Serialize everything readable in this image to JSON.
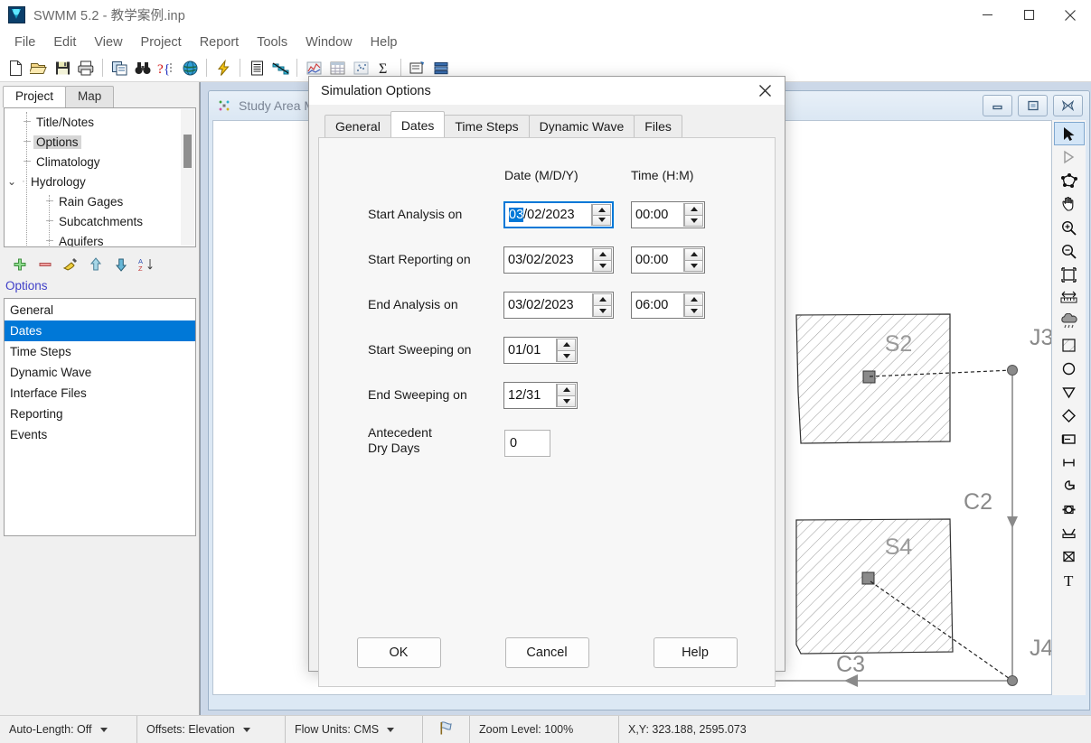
{
  "window": {
    "title": "SWMM 5.2 - 教学案例.inp",
    "icon": "swmm-app-icon",
    "minimize": "minimize-icon",
    "maximize": "maximize-icon",
    "close": "close-icon"
  },
  "menubar": {
    "items": [
      "File",
      "Edit",
      "View",
      "Project",
      "Report",
      "Tools",
      "Window",
      "Help"
    ]
  },
  "toolbar": {
    "groups": [
      [
        "new-file-icon",
        "open-folder-icon",
        "save-disk-icon",
        "print-icon"
      ],
      [
        "copy-icon",
        "find-binoculars-icon",
        "query-icon",
        "globe-icon"
      ],
      [
        "run-lightning-icon"
      ],
      [
        "report-document-icon",
        "profile-plot-icon"
      ],
      [
        "time-series-chart-icon",
        "table-icon",
        "scatter-plot-icon",
        "statistics-sigma-icon"
      ],
      [
        "map-overview-icon",
        "layers-icon"
      ]
    ]
  },
  "sidebar": {
    "tabs": [
      {
        "label": "Project",
        "active": true
      },
      {
        "label": "Map",
        "active": false
      }
    ],
    "tree": [
      {
        "label": "Title/Notes",
        "depth": 1,
        "selected": false,
        "expandable": false
      },
      {
        "label": "Options",
        "depth": 1,
        "selected": true,
        "expandable": false
      },
      {
        "label": "Climatology",
        "depth": 1,
        "selected": false,
        "expandable": false
      },
      {
        "label": "Hydrology",
        "depth": 0,
        "selected": false,
        "expandable": true,
        "expanded": true
      },
      {
        "label": "Rain Gages",
        "depth": 2,
        "selected": false,
        "expandable": false
      },
      {
        "label": "Subcatchments",
        "depth": 2,
        "selected": false,
        "expandable": false
      },
      {
        "label": "Aquifers",
        "depth": 2,
        "selected": false,
        "expandable": false
      }
    ],
    "mini_toolbar": [
      "add-plus-icon",
      "delete-minus-icon",
      "edit-pencil-icon",
      "move-up-icon",
      "move-down-icon",
      "sort-az-icon"
    ],
    "caption": "Options",
    "options_list": [
      {
        "label": "General",
        "selected": false
      },
      {
        "label": "Dates",
        "selected": true
      },
      {
        "label": "Time Steps",
        "selected": false
      },
      {
        "label": "Dynamic Wave",
        "selected": false
      },
      {
        "label": "Interface Files",
        "selected": false
      },
      {
        "label": "Reporting",
        "selected": false
      },
      {
        "label": "Events",
        "selected": false
      }
    ]
  },
  "map_window": {
    "title": "Study Area Map",
    "icon": "study-area-map-icon",
    "minimize": "restore-down-icon",
    "maximize": "maximize-window-icon",
    "close": "close-window-icon",
    "labels": {
      "s2": "S2",
      "s4": "S4",
      "j3": "J3",
      "j4": "J4",
      "c2": "C2",
      "c3": "C3"
    },
    "tools": [
      {
        "name": "select-object-arrow-icon",
        "active": true
      },
      {
        "name": "select-vertex-arrow-icon",
        "active": false
      },
      {
        "name": "select-region-polygon-icon",
        "active": false
      },
      {
        "name": "pan-hand-icon",
        "active": false
      },
      {
        "name": "zoom-in-icon",
        "active": false
      },
      {
        "name": "zoom-out-icon",
        "active": false
      },
      {
        "name": "full-extent-icon",
        "active": false
      },
      {
        "name": "measure-distance-icon",
        "active": false
      },
      {
        "name": "add-rain-gage-icon",
        "active": false
      },
      {
        "name": "add-subcatchment-icon",
        "active": false
      },
      {
        "name": "add-junction-node-icon",
        "active": false
      },
      {
        "name": "add-outfall-node-icon",
        "active": false
      },
      {
        "name": "add-divider-node-icon",
        "active": false
      },
      {
        "name": "add-storage-unit-icon",
        "active": false
      },
      {
        "name": "add-conduit-link-icon",
        "active": false
      },
      {
        "name": "add-pump-link-icon",
        "active": false
      },
      {
        "name": "add-orifice-link-icon",
        "active": false
      },
      {
        "name": "add-weir-link-icon",
        "active": false
      },
      {
        "name": "add-outlet-link-icon",
        "active": false
      },
      {
        "name": "add-label-text-icon",
        "active": false
      }
    ]
  },
  "dialog": {
    "title": "Simulation Options",
    "close": "close-icon",
    "tabs": [
      {
        "label": "General",
        "active": false
      },
      {
        "label": "Dates",
        "active": true
      },
      {
        "label": "Time Steps",
        "active": false
      },
      {
        "label": "Dynamic Wave",
        "active": false
      },
      {
        "label": "Files",
        "active": false
      }
    ],
    "column_headers": {
      "date": "Date (M/D/Y)",
      "time": "Time (H:M)"
    },
    "fields": [
      {
        "label": "Start Analysis on",
        "date_value": "03/02/2023",
        "date_selected_part": "03",
        "date_focused": true,
        "time_value": "00:00"
      },
      {
        "label": "Start Reporting on",
        "date_value": "03/02/2023",
        "date_focused": false,
        "time_value": "00:00"
      },
      {
        "label": "End Analysis on",
        "date_value": "03/02/2023",
        "date_focused": false,
        "time_value": "06:00"
      }
    ],
    "sweeping": [
      {
        "label": "Start Sweeping on",
        "value": "01/01"
      },
      {
        "label": "End Sweeping on",
        "value": "12/31"
      }
    ],
    "antecedent": {
      "label_line1": "Antecedent",
      "label_line2": "Dry Days",
      "value": "0"
    },
    "buttons": [
      {
        "label": "OK",
        "name": "ok-button"
      },
      {
        "label": "Cancel",
        "name": "cancel-button"
      },
      {
        "label": "Help",
        "name": "help-button"
      }
    ]
  },
  "statusbar": {
    "auto_length": "Auto-Length: Off",
    "offsets": "Offsets: Elevation",
    "flow_units": "Flow Units: CMS",
    "flag_icon": "run-status-flag-icon",
    "zoom_level": "Zoom Level: 100%",
    "coordinates": "X,Y: 323.188, 2595.073"
  },
  "colors": {
    "accent": "#0078d7",
    "selection": "#0078d7",
    "mdi_background": "#ccd8e8",
    "panel_background": "#f0f0f0",
    "caption_text": "#4040c8"
  }
}
